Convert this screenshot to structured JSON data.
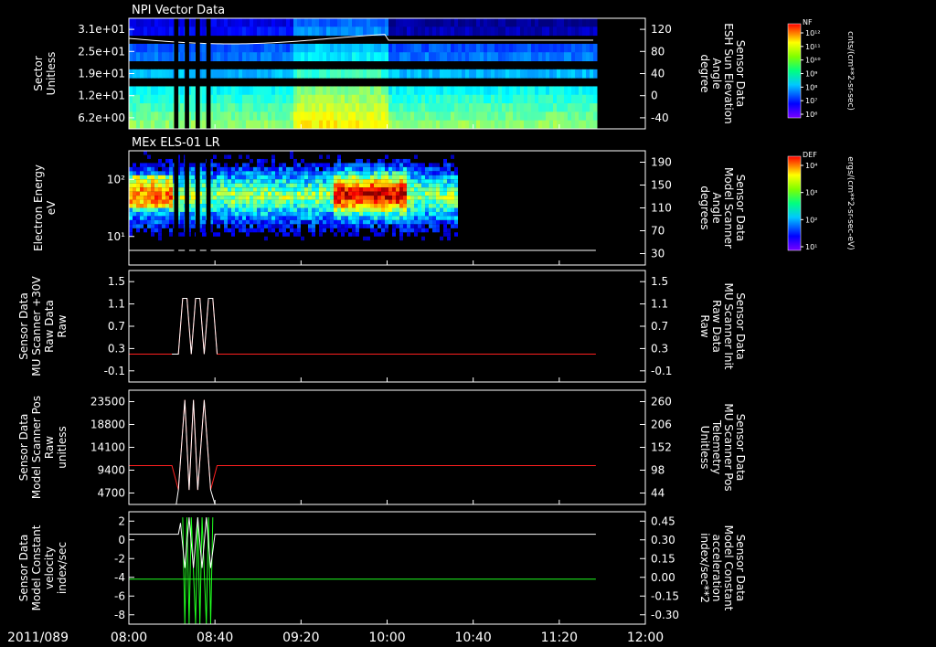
{
  "date_label": "2011/089",
  "time_axis": {
    "min": 480,
    "max": 720,
    "ticks": [
      "08:00",
      "08:40",
      "09:20",
      "10:00",
      "10:40",
      "11:20",
      "12:00"
    ],
    "tick_values": [
      480,
      520,
      560,
      600,
      640,
      680,
      720
    ]
  },
  "panels": [
    {
      "id": "npi",
      "title": "NPI Vector Data",
      "type": "heatmap",
      "left_label": [
        "Sector",
        "Unitless"
      ],
      "left_ticks": [
        "3.1e+01",
        "2.5e+01",
        "1.9e+01",
        "1.2e+01",
        "6.2e+00"
      ],
      "right_label": [
        "Sensor Data",
        "ESH Sun Elevation",
        "Angle",
        "degree"
      ],
      "right_ticks": [
        "120",
        "80",
        "40",
        "0",
        "-40"
      ],
      "data_end_min": 697,
      "colorbar": {
        "label": "NF",
        "unit": "cnts/(cm**2-sr-sec)",
        "ticks": [
          "10¹²",
          "10¹¹",
          "10¹⁰",
          "10⁹",
          "10⁸",
          "10⁷",
          "10⁶"
        ]
      }
    },
    {
      "id": "els",
      "title": "MEx ELS-01 LR",
      "type": "heatmap",
      "left_label": [
        "Electron Energy",
        "eV"
      ],
      "left_ticks": [
        "10²",
        "10¹"
      ],
      "right_label": [
        "Sensor Data",
        "Model Scanner",
        "Angle",
        "degrees"
      ],
      "right_ticks": [
        "190",
        "150",
        "110",
        "70",
        "30"
      ],
      "data_end_min": 632,
      "colorbar": {
        "label": "DEF",
        "unit": "ergs/(cm**2-sr-sec-eV)",
        "ticks": [
          "10⁴",
          "10³",
          "10²",
          "10¹"
        ]
      }
    },
    {
      "id": "mu_raw",
      "type": "line",
      "left_label": [
        "Sensor Data",
        "MU Scanner +30V",
        "Raw Data",
        "Raw"
      ],
      "left_ticks": [
        "1.5",
        "1.1",
        "0.7",
        "0.3",
        "-0.1"
      ],
      "right_label": [
        "Sensor Data",
        "MU Scanner Init",
        "Raw Data",
        "Raw"
      ],
      "right_ticks": [
        "1.5",
        "1.1",
        "0.7",
        "0.3",
        "-0.1"
      ],
      "ylim": [
        -0.5,
        1.5
      ],
      "series": [
        {
          "color": "#ff2020",
          "x": [
            480,
            490,
            500,
            503,
            505,
            507,
            509,
            511,
            513,
            515,
            517,
            519,
            521,
            530,
            600,
            697
          ],
          "y": [
            0,
            0,
            0,
            0,
            1,
            1,
            0,
            1,
            1,
            0,
            1,
            1,
            0,
            0,
            0,
            0
          ]
        },
        {
          "color": "#ffffff",
          "x": [
            500,
            503,
            505,
            507,
            509,
            511,
            513,
            515,
            517,
            519,
            521
          ],
          "y": [
            0,
            0,
            1,
            1,
            0,
            1,
            1,
            0,
            1,
            1,
            0
          ]
        }
      ]
    },
    {
      "id": "mu_pos",
      "type": "line",
      "left_label": [
        "Sensor Data",
        "Model Scanner Pos",
        "Raw",
        "unitless"
      ],
      "left_ticks": [
        "23500",
        "18800",
        "14100",
        "9400",
        "4700"
      ],
      "right_label": [
        "Sensor Data",
        "MU Scanner Pos",
        "Telemetry",
        "Unitless"
      ],
      "right_ticks": [
        "260",
        "206",
        "152",
        "98",
        "44"
      ],
      "ylim": [
        0,
        23500
      ],
      "series": [
        {
          "color": "#ff2020",
          "x": [
            480,
            500,
            503,
            506,
            508,
            510,
            512,
            515,
            518,
            521,
            697
          ],
          "y": [
            8000,
            8000,
            3000,
            21500,
            3000,
            21500,
            3000,
            21500,
            3000,
            8000,
            8000
          ]
        },
        {
          "color": "#ffffff",
          "x": [
            502,
            503,
            506,
            508,
            510,
            512,
            515,
            518,
            520
          ],
          "y": [
            0,
            3000,
            21500,
            3000,
            21500,
            3000,
            21500,
            3000,
            0
          ]
        }
      ]
    },
    {
      "id": "const",
      "type": "line",
      "left_label": [
        "Sensor Data",
        "Model Constant",
        "velocity",
        "index/sec"
      ],
      "left_ticks": [
        "2",
        "0",
        "-2",
        "-4",
        "-6",
        "-8"
      ],
      "right_label": [
        "Sensor Data",
        "Model Constant",
        "acceleration",
        "index/sec**2"
      ],
      "right_ticks": [
        "0.45",
        "0.30",
        "0.15",
        "0.00",
        "-0.15",
        "-0.30"
      ],
      "ylim": [
        -8,
        2
      ],
      "series": [
        {
          "color": "#20ff20",
          "x": [
            480,
            697
          ],
          "y": [
            -4,
            -4
          ]
        },
        {
          "color": "#20ff20",
          "x": [
            505,
            506,
            507,
            508,
            509,
            511,
            512,
            513,
            514,
            516,
            517,
            518,
            519
          ],
          "y": [
            1.5,
            -8,
            1.5,
            -8,
            1.5,
            -8,
            1.5,
            -8,
            1.5,
            -8,
            1.5,
            -8,
            1.5
          ]
        },
        {
          "color": "#ffffff",
          "x": [
            480,
            503,
            504,
            506,
            508,
            510,
            512,
            514,
            516,
            518,
            520,
            697
          ],
          "y": [
            0,
            0,
            1,
            -3,
            1.5,
            -3,
            1.5,
            -3,
            1.5,
            -3,
            0,
            0
          ]
        }
      ]
    }
  ]
}
